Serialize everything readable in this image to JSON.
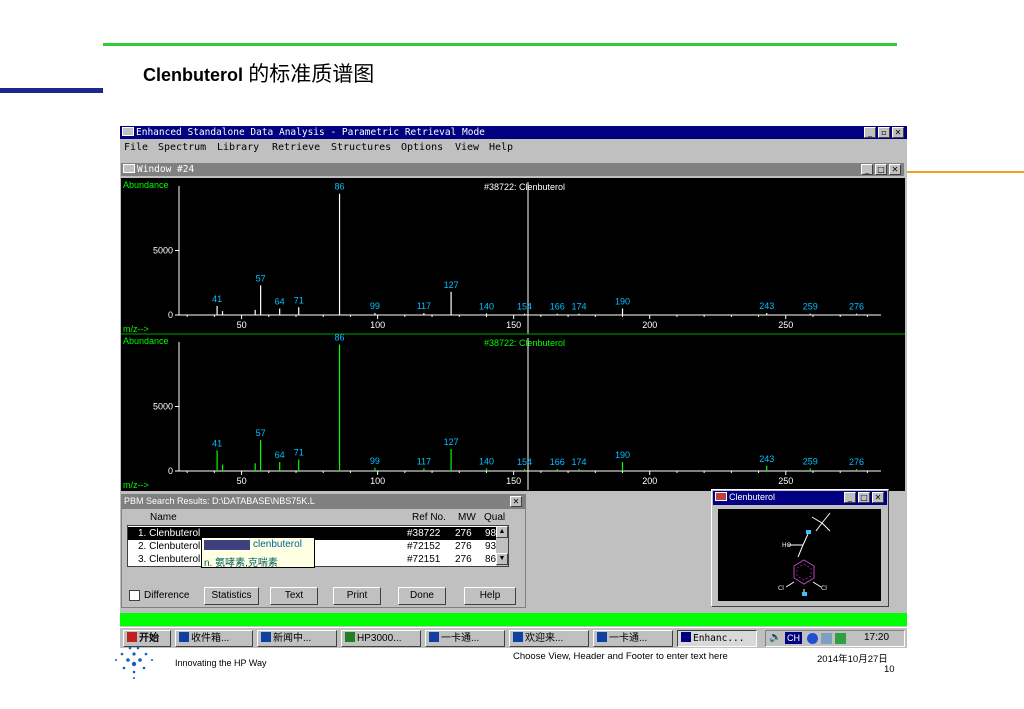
{
  "slide": {
    "title_en": "Clenbuterol",
    "title_zh": " 的标准质谱图",
    "tagline": "Innovating the HP Way",
    "footer_text": "Choose View, Header and Footer to enter text here",
    "date": "2014年10月27日",
    "page_number": "10"
  },
  "app": {
    "title": "Enhanced Standalone Data Analysis - Parametric Retrieval Mode",
    "menu": [
      "File",
      "Spectrum",
      "Library",
      "Retrieve",
      "Structures",
      "Options",
      "View",
      "Help"
    ],
    "window_title": "Window #24"
  },
  "chart_data": [
    {
      "type": "bar",
      "title": "#38722: Clenbuterol",
      "ylabel": "Abundance",
      "xlabel": "m/z-->",
      "color": "#ffffff",
      "xlim": [
        27,
        285
      ],
      "ylim": [
        0,
        10000
      ],
      "yticks": [
        0,
        5000
      ],
      "xticks": [
        50,
        100,
        150,
        200,
        250
      ],
      "labeled_peaks": [
        41,
        57,
        64,
        71,
        86,
        99,
        117,
        127,
        140,
        154,
        166,
        174,
        190,
        243,
        259,
        276
      ],
      "x": [
        41,
        43,
        55,
        57,
        64,
        71,
        86,
        99,
        117,
        127,
        140,
        154,
        166,
        174,
        190,
        243,
        259,
        276
      ],
      "values": [
        700,
        300,
        400,
        2300,
        500,
        600,
        9400,
        150,
        150,
        1800,
        120,
        100,
        100,
        100,
        500,
        150,
        100,
        100
      ]
    },
    {
      "type": "bar",
      "title": "#38722: Clenbuterol",
      "ylabel": "Abundance",
      "xlabel": "m/z-->",
      "color": "#00ff00",
      "xlim": [
        27,
        285
      ],
      "ylim": [
        0,
        10000
      ],
      "yticks": [
        0,
        5000
      ],
      "xticks": [
        50,
        100,
        150,
        200,
        250
      ],
      "labeled_peaks": [
        41,
        57,
        64,
        71,
        86,
        99,
        117,
        127,
        140,
        154,
        166,
        174,
        190,
        243,
        259,
        276
      ],
      "x": [
        41,
        43,
        55,
        57,
        64,
        71,
        86,
        99,
        117,
        127,
        140,
        154,
        166,
        174,
        190,
        243,
        259,
        276
      ],
      "values": [
        1600,
        500,
        600,
        2400,
        700,
        900,
        9800,
        250,
        200,
        1700,
        200,
        150,
        150,
        150,
        700,
        400,
        200,
        150
      ]
    }
  ],
  "pbm": {
    "title": "PBM Search Results: D:\\DATABASE\\NBS75K.L",
    "columns": [
      "Name",
      "Ref No.",
      "MW",
      "Qual"
    ],
    "rows": [
      {
        "name": "1.  Clenbuterol",
        "ref": "#38722",
        "mw": "276",
        "qual": "98"
      },
      {
        "name": "2.  Clenbuterol",
        "ref": "#72152",
        "mw": "276",
        "qual": "93"
      },
      {
        "name": "3.  Clenbuterol",
        "ref": "#72151",
        "mw": "276",
        "qual": "86"
      }
    ],
    "difference_label": "Difference",
    "buttons": [
      "Statistics",
      "Text",
      "Print",
      "Done",
      "Help"
    ]
  },
  "tooltip": {
    "word": "clenbuterol",
    "translation": "n. 氨哮素,克喘素"
  },
  "structure": {
    "title": "Clenbuterol"
  },
  "taskbar": {
    "items": [
      "开始",
      "收件箱...",
      "新闻中...",
      "HP3000...",
      "一卡通...",
      "欢迎来...",
      "一卡通...",
      "Enhanc..."
    ],
    "lang": "CH",
    "clock": "17:20"
  }
}
